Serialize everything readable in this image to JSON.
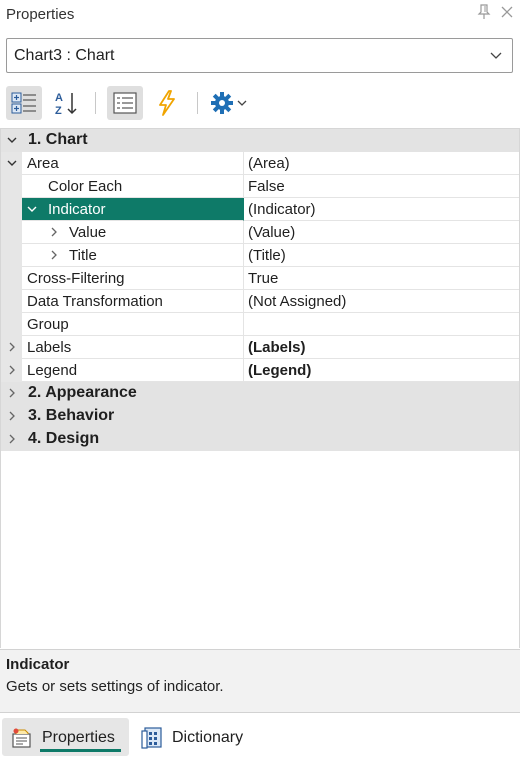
{
  "panel": {
    "title": "Properties",
    "pin_icon": "pin-icon",
    "close_icon": "close-icon"
  },
  "selector": {
    "value": "Chart3 : Chart",
    "icon": "chevron-down-icon"
  },
  "toolbar": {
    "buttons": [
      {
        "name": "categorized-view",
        "icon": "categorized-icon",
        "active": true
      },
      {
        "name": "alphabetical-sort",
        "icon": "sort-az-icon",
        "active": false
      },
      {
        "name": "properties-view",
        "icon": "properties-list-icon",
        "active": true
      },
      {
        "name": "events-view",
        "icon": "lightning-icon",
        "active": false
      },
      {
        "name": "settings",
        "icon": "gear-icon",
        "active": false
      }
    ]
  },
  "grid": {
    "categories": [
      {
        "label": "1. Chart",
        "expanded": true
      },
      {
        "label": "2. Appearance",
        "expanded": false
      },
      {
        "label": "3. Behavior",
        "expanded": false
      },
      {
        "label": "4. Design",
        "expanded": false
      }
    ],
    "rows": [
      {
        "name": "Area",
        "value": "(Area)"
      },
      {
        "name": "Color Each",
        "value": "False"
      },
      {
        "name": "Indicator",
        "value": "(Indicator)"
      },
      {
        "name": "Value",
        "value": "(Value)"
      },
      {
        "name": "Title",
        "value": "(Title)"
      },
      {
        "name": "Cross-Filtering",
        "value": "True"
      },
      {
        "name": "Data Transformation",
        "value": "(Not Assigned)"
      },
      {
        "name": "Group",
        "value": ""
      },
      {
        "name": "Labels",
        "value": "(Labels)"
      },
      {
        "name": "Legend",
        "value": "(Legend)"
      }
    ]
  },
  "description": {
    "title": "Indicator",
    "text": "Gets or sets settings of indicator."
  },
  "tabs": [
    {
      "label": "Properties",
      "icon": "properties-tab-icon",
      "active": true
    },
    {
      "label": "Dictionary",
      "icon": "dictionary-icon",
      "active": false
    }
  ],
  "colors": {
    "accent": "#0e7a68",
    "category_bg": "#e3e3e3",
    "gear": "#1f6fb5",
    "lightning": "#f0a400"
  }
}
